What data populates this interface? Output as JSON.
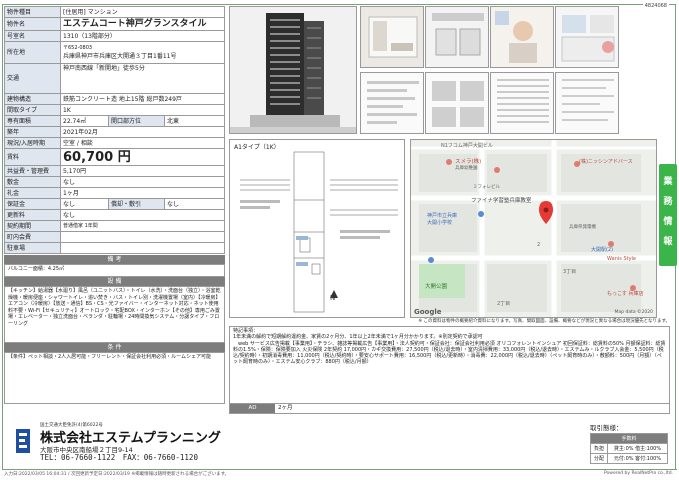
{
  "ref_no": "4824068",
  "spec": {
    "type_label": "物件種目",
    "type_value": "[住居用] マンション",
    "name_label": "物件名",
    "name_value": "エステムコート神戸グランスタイル",
    "room_label": "号室名",
    "room_value": "1310（13階部分）",
    "addr_label": "所在地",
    "zip": "〒652-0803",
    "addr_value": "兵庫県神戸市兵庫区大開通３丁目1番11号",
    "access_label": "交通",
    "access_value": "神戸南西線「新開地」徒歩5分",
    "structure_label": "建物構造",
    "structure_value": "鉄筋コンクリート造 地上15階 総戸数249戸",
    "layout_label": "間取タイプ",
    "layout_value": "1K",
    "area_label": "専有面積",
    "area_value": "22.74㎡",
    "direction_label": "開口部方位",
    "direction_value": "北東",
    "built_label": "築年",
    "built_value": "2021年02月",
    "status_label": "現況/入居時期",
    "status_value": "空室 / 相談",
    "rent_label": "賃料",
    "rent_value": "60,700 円",
    "fee_label": "共益費・管理費",
    "fee_value": "5,170円",
    "deposit_label": "敷金",
    "deposit_value": "なし",
    "key_label": "礼金",
    "key_value": "1ヶ月",
    "hosho_label": "保証金",
    "hosho_value": "なし",
    "shokyaku_label": "償却・敷引",
    "shokyaku_value": "なし",
    "renewal_label": "更新料",
    "renewal_value": "なし",
    "contract_label": "契約期間",
    "contract_value": "普通借家 1年間",
    "town_label": "町内会費",
    "town_value": "",
    "parking_label": "駐車場",
    "parking_value": ""
  },
  "notes": {
    "header": "備 考",
    "body": "バルコニー面積：4.25㎡"
  },
  "facilities": {
    "header": "設 備",
    "body": "【キッチン】給湯器【水廻り】風呂（ユニットバス）・トイレ（水洗）・洗面台（独立）・浴室乾燥機・暖房便座・シャワートイレ・追い焚き・バス・トイレ別・洗濯機置場（室内）【冷暖房】エアコン（冷暖房）【放送・通信】BS・CS・光ファイバー・インターネット対応・ネット使用料不要・Wi-Fi【セキュリティ】オートロック・宅配BOX・インターホン【その他】専用ごみ置場・エレベーター・独立洗面台・ベランダ・駐輪場・24時間換気システム・分譲タイプ・フローリング"
  },
  "conditions": {
    "header": "条 件",
    "body": "【条件】ペット相談・2人入居可能・フリーレント・保証会社利用必須・ルームシェア可能"
  },
  "floorplan": {
    "title": "A1タイプ（1K）",
    "north": "N"
  },
  "map": {
    "labels": [
      "N1フコム神戸大開ビル",
      "スメラ(株)",
      "兵庫幼稚園",
      "ミフォレビル",
      "ファイナ学習塾兵庫教室",
      "神戸市立兵庫",
      "大開小学校",
      "(株)ニッシンアドバース",
      "兵庫県発電機",
      "大開公園",
      "大開駅(2)",
      "Wanis Style",
      "もっこす 兵庫店",
      "3丁目",
      "2",
      "2丁目"
    ],
    "google": "Google",
    "copyright": "Map data ©2020"
  },
  "disclaimer": "※ この資料は物件の概要紹介資料になります。写真、間取図面、設備、概要などが現況と異なる場合は現況優先となります。",
  "remarks": {
    "title": "特記事項：",
    "body": "1年未満の解約で短期解約違約金、家賃の2ヶ月分、1年以上2年未満で1ヶ月分かかります。※別定契約で承認可\n　web サービス広告掲載【事業用】・チラシ、雑誌等掲載広告【事業用】・法人契約可・保証会社：保証会社利用必須 オリコフォレントインシュア 初回保証料：総賃料の50% 月額保証料：総賃料の1.5%・保険：保険要加入 火災保険 2年契約 17,000円・カギ交換費用：27,500円（税込/退去時）・室内清掃費用：33,000円（税込/退去時）・エステムみ・ルクラブ入会金：5,500円（税込/契約時）・初期消毒費用：11,000円（税込/契約時）・要安心サポート費用：16,500円（税込/更新時）・消毒費：22,000円（税込/退去時）（ペット飼育時のみ）・敷額料：500円（月額）（ペット飼育時のみ）・エステム安心クラブ：880円（税込/月額）"
  },
  "ad": {
    "label": "AD",
    "value": "2ヶ月"
  },
  "side_tab": [
    "業",
    "務",
    "情",
    "報"
  ],
  "company": {
    "license": "国土交通大臣免許(4)第6022号",
    "name": "株式会社エステムプランニング",
    "address": "大阪市中央区南船場２丁目9-14",
    "tel": "TEL：06-7660-1122　FAX：06-7660-1120"
  },
  "deal": {
    "label": "取引態様：",
    "header": "手数料",
    "rows": [
      {
        "k": "負担",
        "v": "貸主:0% 借主:100%"
      },
      {
        "k": "分配",
        "v": "元付:0% 客付:100%"
      }
    ]
  },
  "footer": {
    "left": "入力日:2022/03/05 16:04:31 / 次回更新予定日:2022/03/19 ※掲載情報は随時更新される場合がございます。",
    "right": "Powered by RealNetPro co.,ltd."
  },
  "colors": {
    "label_bg": "#dfe6ef",
    "section_head": "#7d7d7d",
    "tab_green": "#3bb54a"
  }
}
